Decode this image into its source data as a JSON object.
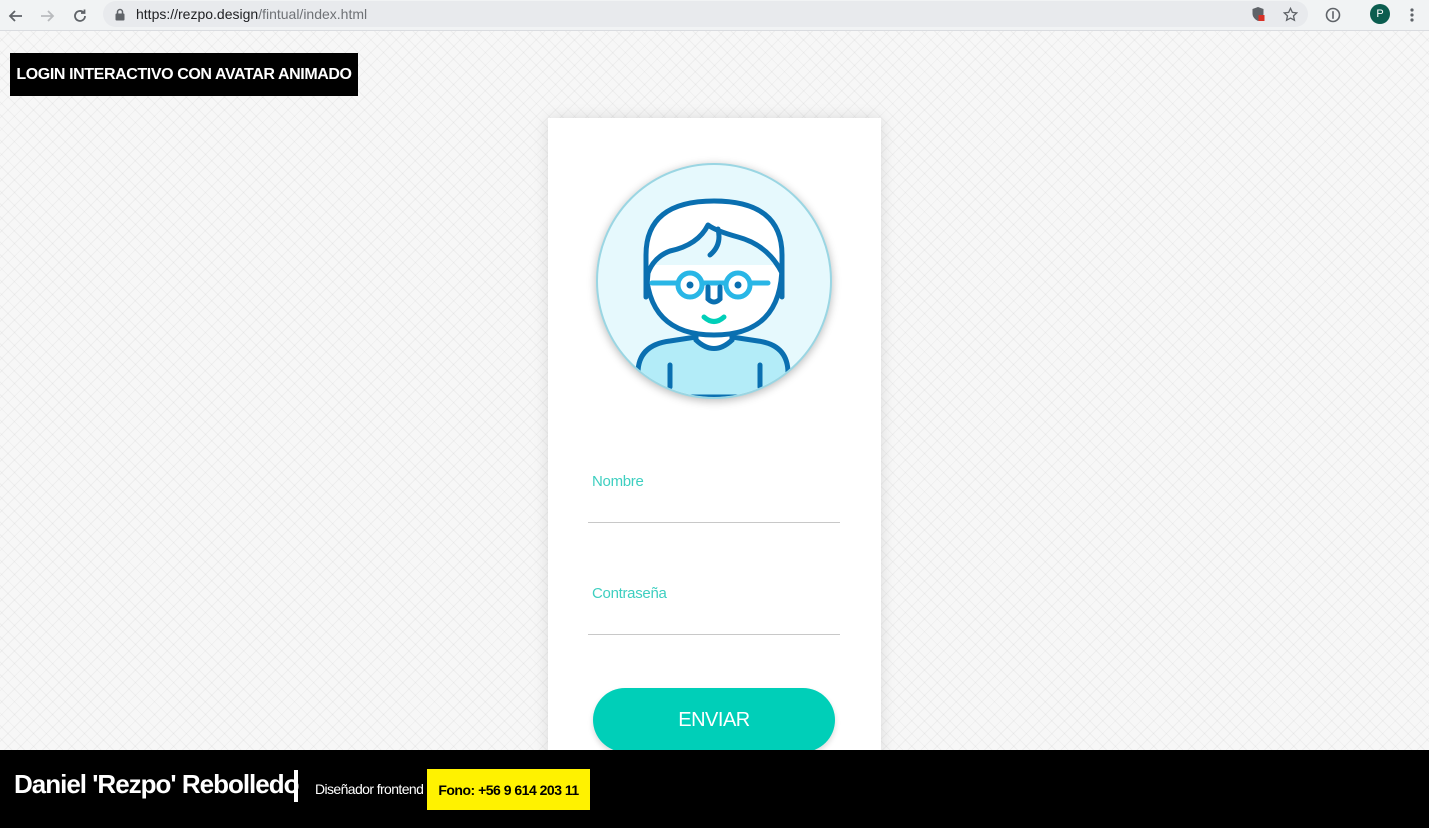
{
  "browser": {
    "url_host": "https://rezpo.design",
    "url_path": "/fintual/index.html",
    "profile_initial": "P"
  },
  "page": {
    "title": "LOGIN INTERACTIVO CON AVATAR ANIMADO"
  },
  "login": {
    "name_label": "Nombre",
    "name_value": "",
    "password_label": "Contraseña",
    "password_value": "",
    "submit_label": "ENVIAR"
  },
  "footer": {
    "author": "Daniel 'Rezpo' Rebolledo",
    "role": "Diseñador frontend",
    "phone": "Fono: +56 9 614 203 11"
  },
  "colors": {
    "accent": "#00cfb8",
    "label": "#3ecfc0",
    "avatar_line": "#0a6fb0",
    "glasses": "#29b6e6",
    "phone_badge": "#fff200"
  },
  "icons": [
    "back-arrow-icon",
    "forward-arrow-icon",
    "reload-icon",
    "lock-icon",
    "shield-icon",
    "star-icon",
    "info-icon",
    "kebab-menu-icon"
  ]
}
